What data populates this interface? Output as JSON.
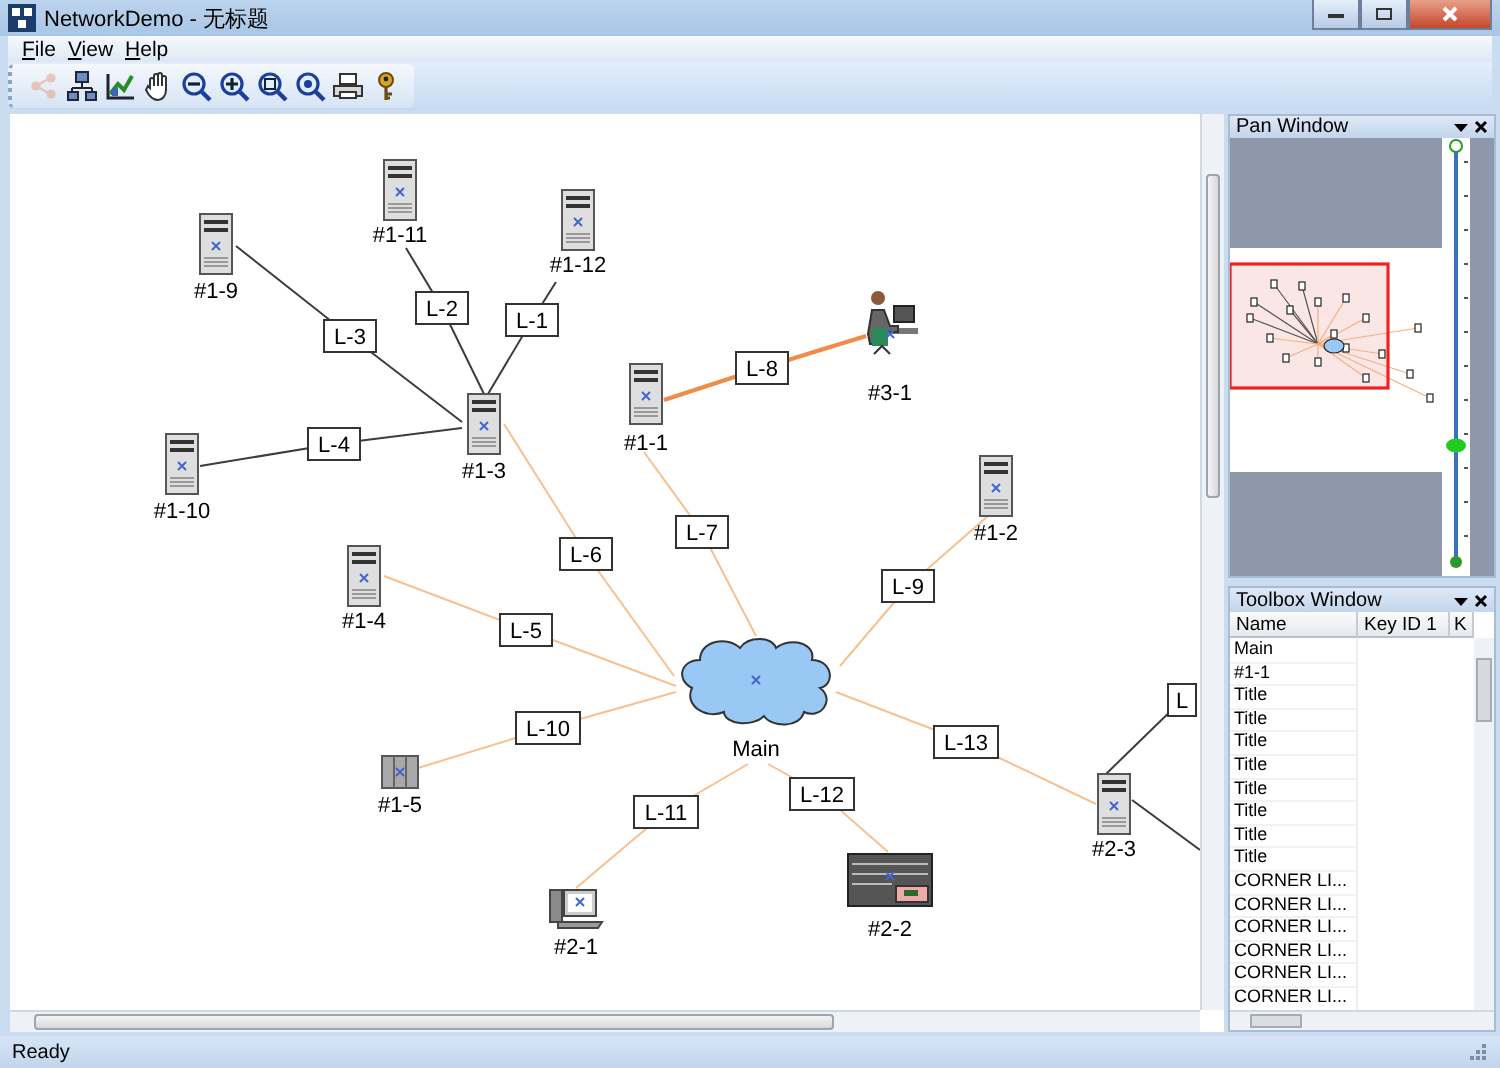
{
  "window": {
    "title": "NetworkDemo - 无标题"
  },
  "menu": [
    {
      "label": "File"
    },
    {
      "label": "View"
    },
    {
      "label": "Help"
    }
  ],
  "toolbar": [
    {
      "kind": "connect",
      "disabled": true
    },
    {
      "kind": "network",
      "disabled": false
    },
    {
      "kind": "chart",
      "disabled": false
    },
    {
      "kind": "pan",
      "disabled": false
    },
    {
      "kind": "zoom-out",
      "disabled": false
    },
    {
      "kind": "zoom-in",
      "disabled": false
    },
    {
      "kind": "zoom-area",
      "disabled": false
    },
    {
      "kind": "zoom-fit",
      "disabled": false
    },
    {
      "kind": "print",
      "disabled": false
    },
    {
      "kind": "about",
      "disabled": false
    }
  ],
  "diagram": {
    "nodes": [
      {
        "label": "#1-11",
        "kind": "server"
      },
      {
        "label": "#1-12",
        "kind": "server"
      },
      {
        "label": "#1-9",
        "kind": "server"
      },
      {
        "label": "#3-1",
        "kind": "user"
      },
      {
        "label": "#1-1",
        "kind": "server"
      },
      {
        "label": "#1-3",
        "kind": "server"
      },
      {
        "label": "#1-10",
        "kind": "server"
      },
      {
        "label": "#1-2",
        "kind": "server"
      },
      {
        "label": "#1-4",
        "kind": "server"
      },
      {
        "label": "Main",
        "kind": "cloud"
      },
      {
        "label": "#1-5",
        "kind": "cabinet"
      },
      {
        "label": "#2-3",
        "kind": "server"
      },
      {
        "label": "#2-2",
        "kind": "chassis"
      },
      {
        "label": "#2-1",
        "kind": "pc"
      }
    ],
    "links": [
      {
        "label": "L-1",
        "color": "#3c3c3c",
        "highlighted": false
      },
      {
        "label": "L-2",
        "color": "#3c3c3c",
        "highlighted": false
      },
      {
        "label": "L-3",
        "color": "#3c3c3c",
        "highlighted": false
      },
      {
        "label": "L-4",
        "color": "#3c3c3c",
        "highlighted": false
      },
      {
        "label": "L-5",
        "color": "#f7c08e",
        "highlighted": false
      },
      {
        "label": "L-6",
        "color": "#f7c08e",
        "highlighted": false
      },
      {
        "label": "L-7",
        "color": "#f7c08e",
        "highlighted": false
      },
      {
        "label": "L-8",
        "color": "#f08c4a",
        "highlighted": true
      },
      {
        "label": "L-9",
        "color": "#f7c08e",
        "highlighted": false
      },
      {
        "label": "L-10",
        "color": "#f7c08e",
        "highlighted": false
      },
      {
        "label": "L-11",
        "color": "#f7c08e",
        "highlighted": false
      },
      {
        "label": "L-12",
        "color": "#f7c08e",
        "highlighted": false
      },
      {
        "label": "L-13",
        "color": "#f7c08e",
        "highlighted": false
      },
      {
        "label": "L",
        "color": "#3c3c3c",
        "highlighted": false
      }
    ]
  },
  "pan_window": {
    "title": "Pan Window",
    "zoom_slider": {
      "level": 0.28
    }
  },
  "toolbox_window": {
    "title": "Toolbox Window",
    "columns": [
      "Name",
      "Key ID 1",
      "K"
    ],
    "rows": [
      {
        "name": "Main"
      },
      {
        "name": "#1-1"
      },
      {
        "name": "Title"
      },
      {
        "name": "Title"
      },
      {
        "name": "Title"
      },
      {
        "name": "Title"
      },
      {
        "name": "Title"
      },
      {
        "name": "Title"
      },
      {
        "name": "Title"
      },
      {
        "name": "Title"
      },
      {
        "name": "CORNER LI..."
      },
      {
        "name": "CORNER LI..."
      },
      {
        "name": "CORNER LI..."
      },
      {
        "name": "CORNER LI..."
      },
      {
        "name": "CORNER LI..."
      },
      {
        "name": "CORNER LI..."
      }
    ]
  },
  "status_bar": {
    "text": "Ready"
  }
}
